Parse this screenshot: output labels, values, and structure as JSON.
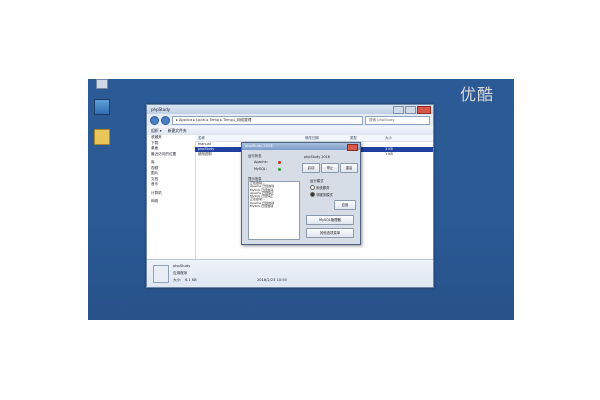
{
  "watermark": "优酷",
  "desktop_icons": [
    {
      "label": "",
      "icon": "recycle-bin-icon"
    },
    {
      "label": "",
      "icon": "computer-icon"
    },
    {
      "label": "",
      "icon": "folder-icon"
    }
  ],
  "explorer": {
    "title": "phpStudy",
    "address": "▸ Applica ▸ Local ▸ Temp ▸ Temp1_网络整理",
    "search_placeholder": "搜索 phpStudy",
    "toolbar": [
      "组织 ▾",
      "新建文件夹"
    ],
    "nav_items": [
      "收藏夹",
      "下载",
      "桌面",
      "最近访问的位置",
      "库",
      "视频",
      "图片",
      "文档",
      "音乐",
      "计算机",
      "网络"
    ],
    "columns": [
      "名称",
      "修改日期",
      "类型",
      "大小"
    ],
    "files": [
      {
        "name": "manual",
        "size": ""
      },
      {
        "name": "phpStudy",
        "size": "3 KB",
        "selected": true
      },
      {
        "name": "使用说明",
        "size": "1 KB"
      }
    ],
    "details": {
      "name": "phpStudy",
      "type": "应用程序",
      "size_label": "大小:",
      "size": "6.1 KB",
      "modified": "2016/2/23 10:50"
    }
  },
  "dialog": {
    "title": "phpStudy 2016",
    "status_heading": "运行状态",
    "services": [
      {
        "name": "Apache:",
        "status_color": "#d62b1f"
      },
      {
        "name": "MySQL:",
        "status_color": "#2aa52a"
      }
    ],
    "buttons": {
      "start": "启动",
      "stop": "停止",
      "restart": "重启",
      "apply": "应用",
      "mysql_manager": "MySQL管理器",
      "other_menu": "其他选项菜单"
    },
    "version_label": "phpStudy 2016",
    "log_heading": "提示信息",
    "log_lines": [
      "正在启动...",
      "Apache 已经启动",
      "MySQL 已经启动",
      "Apache 已经停止",
      "MySQL 已经停止",
      "正在启动...",
      "Apache 已经启动",
      "MySQL 已经启动"
    ],
    "mode_heading": "运行模式",
    "mode_options": [
      "系统服务",
      "非服务模式"
    ]
  }
}
